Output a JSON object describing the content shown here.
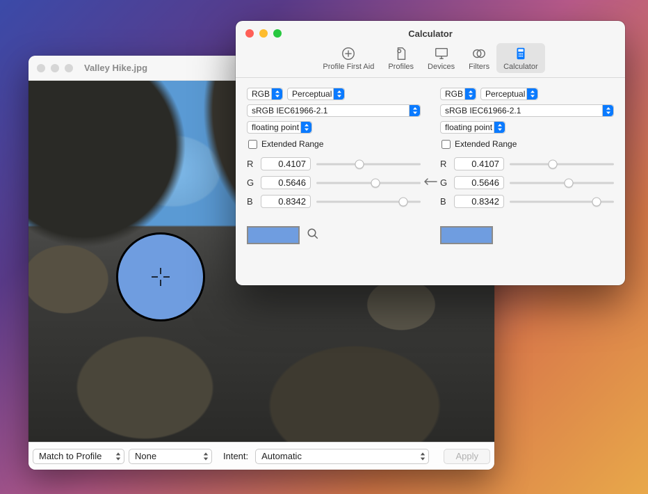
{
  "image_window": {
    "title": "Valley Hike.jpg",
    "dropper_sample_hex": "#6f9de0",
    "footer": {
      "mode": "Match to Profile",
      "profile": "None",
      "intent_label": "Intent:",
      "intent": "Automatic",
      "apply_label": "Apply"
    }
  },
  "calc_window": {
    "title": "Calculator",
    "toolbar": {
      "items": [
        {
          "label": "Profile First Aid",
          "active": false,
          "icon": "plus-circle"
        },
        {
          "label": "Profiles",
          "active": false,
          "icon": "document-gear"
        },
        {
          "label": "Devices",
          "active": false,
          "icon": "monitor"
        },
        {
          "label": "Filters",
          "active": false,
          "icon": "overlap-circles"
        },
        {
          "label": "Calculator",
          "active": true,
          "icon": "calculator"
        }
      ]
    },
    "left": {
      "mode": "RGB",
      "intent": "Perceptual",
      "profile": "sRGB IEC61966-2.1",
      "format": "floating point",
      "extended_range_label": "Extended Range",
      "extended_range": false,
      "channels": [
        {
          "label": "R",
          "value": "0.4107",
          "pos": 0.4107
        },
        {
          "label": "G",
          "value": "0.5646",
          "pos": 0.5646
        },
        {
          "label": "B",
          "value": "0.8342",
          "pos": 0.8342
        }
      ],
      "swatch_hex": "#6f9de0"
    },
    "right": {
      "mode": "RGB",
      "intent": "Perceptual",
      "profile": "sRGB IEC61966-2.1",
      "format": "floating point",
      "extended_range_label": "Extended Range",
      "extended_range": false,
      "channels": [
        {
          "label": "R",
          "value": "0.4107",
          "pos": 0.4107
        },
        {
          "label": "G",
          "value": "0.5646",
          "pos": 0.5646
        },
        {
          "label": "B",
          "value": "0.8342",
          "pos": 0.8342
        }
      ],
      "swatch_hex": "#6f9de0"
    },
    "arrow_direction": "left"
  }
}
